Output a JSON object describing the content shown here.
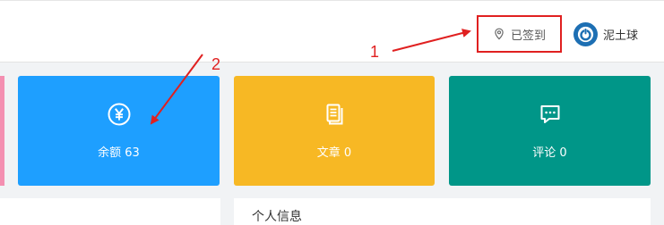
{
  "header": {
    "status_label": "已签到",
    "username": "泥土球"
  },
  "cards": [
    {
      "label": "余额 63",
      "icon": "yen-circle-icon",
      "color": "#1e9fff"
    },
    {
      "label": "文章 0",
      "icon": "document-icon",
      "color": "#f7b824"
    },
    {
      "label": "评论 0",
      "icon": "comment-icon",
      "color": "#009688"
    }
  ],
  "panel": {
    "title": "个人信息"
  },
  "annotations": {
    "one": "1",
    "two": "2",
    "color": "#e02020"
  }
}
